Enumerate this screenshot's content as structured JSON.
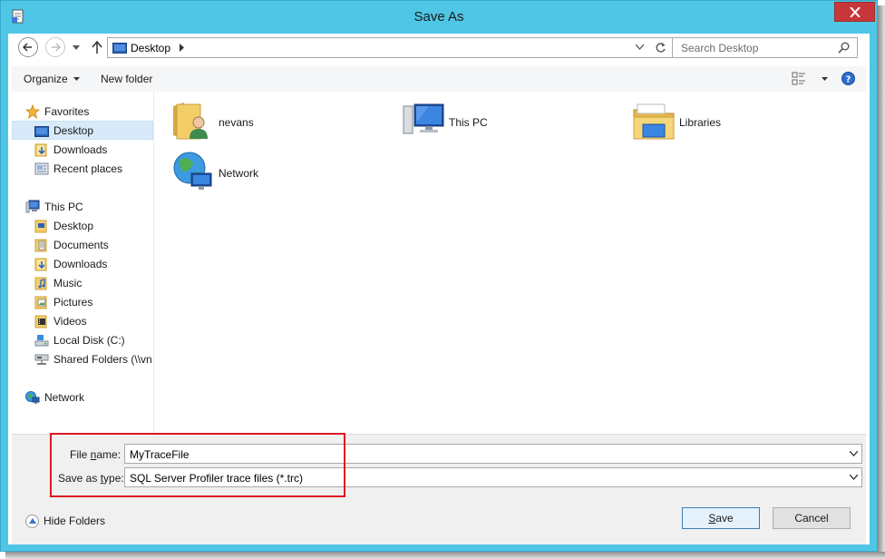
{
  "window": {
    "title": "Save As"
  },
  "address": {
    "location": "Desktop",
    "search_placeholder": "Search Desktop"
  },
  "toolbar": {
    "organize": "Organize",
    "new_folder": "New folder"
  },
  "nav": {
    "favorites_header": "Favorites",
    "favorites": [
      {
        "label": "Desktop",
        "icon": "desktop-icon"
      },
      {
        "label": "Downloads",
        "icon": "downloads-icon"
      },
      {
        "label": "Recent places",
        "icon": "recent-places-icon"
      }
    ],
    "thispc_header": "This PC",
    "thispc": [
      {
        "label": "Desktop",
        "icon": "desktop-icon"
      },
      {
        "label": "Documents",
        "icon": "documents-icon"
      },
      {
        "label": "Downloads",
        "icon": "downloads-icon"
      },
      {
        "label": "Music",
        "icon": "music-icon"
      },
      {
        "label": "Pictures",
        "icon": "pictures-icon"
      },
      {
        "label": "Videos",
        "icon": "videos-icon"
      },
      {
        "label": "Local Disk (C:)",
        "icon": "local-disk-icon"
      },
      {
        "label": "Shared Folders (\\\\vn",
        "icon": "shared-folders-icon"
      }
    ],
    "network_header": "Network"
  },
  "content": {
    "items": [
      {
        "label": "nevans",
        "icon": "user-folder-icon"
      },
      {
        "label": "This PC",
        "icon": "computer-icon"
      },
      {
        "label": "Libraries",
        "icon": "libraries-icon"
      },
      {
        "label": "Network",
        "icon": "network-icon"
      }
    ]
  },
  "form": {
    "file_name_label_pre": "File ",
    "file_name_label_u": "n",
    "file_name_label_post": "ame:",
    "file_name_value": "MyTraceFile",
    "save_type_label_pre": "Save as ",
    "save_type_label_u": "t",
    "save_type_label_post": "ype:",
    "save_type_value": "SQL Server Profiler trace files (*.trc)"
  },
  "footer": {
    "hide_folders": "Hide Folders",
    "save_u": "S",
    "save_rest": "ave",
    "cancel": "Cancel"
  },
  "colors": {
    "title_bar": "#4fc6e6",
    "close_button": "#c7373a",
    "highlight": "#e0161f",
    "selection": "#d8eaf9"
  }
}
